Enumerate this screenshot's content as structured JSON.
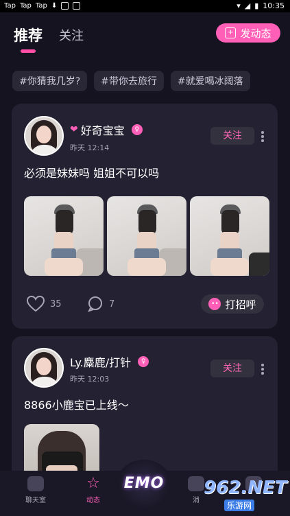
{
  "status_bar": {
    "left_items": [
      "Tap",
      "Tap",
      "Tap"
    ],
    "time": "10:35"
  },
  "header": {
    "tab_recommend": "推荐",
    "tab_follow": "关注",
    "post_button": "发动态"
  },
  "tags": [
    "#你猜我几岁?",
    "#带你去旅行",
    "#就爱喝冰阔落"
  ],
  "posts": [
    {
      "username": "好奇宝宝",
      "time": "昨天 12:14",
      "follow_label": "关注",
      "content": "必须是妹妹吗 姐姐不可以吗",
      "likes": "35",
      "comments": "7",
      "greet_label": "打招呼"
    },
    {
      "username": "Ly.麋鹿/打针",
      "time": "昨天 12:03",
      "follow_label": "关注",
      "content": "8866小鹿宝已上线～"
    }
  ],
  "bottom_nav": {
    "chat_room": "聊天室",
    "moments": "动态",
    "center_logo": "EMO",
    "item4": "消"
  },
  "watermark": {
    "top": "962.NET",
    "bottom": "乐游网"
  },
  "colors": {
    "accent": "#ff5fb7",
    "background": "#15131f",
    "card": "#232132"
  }
}
